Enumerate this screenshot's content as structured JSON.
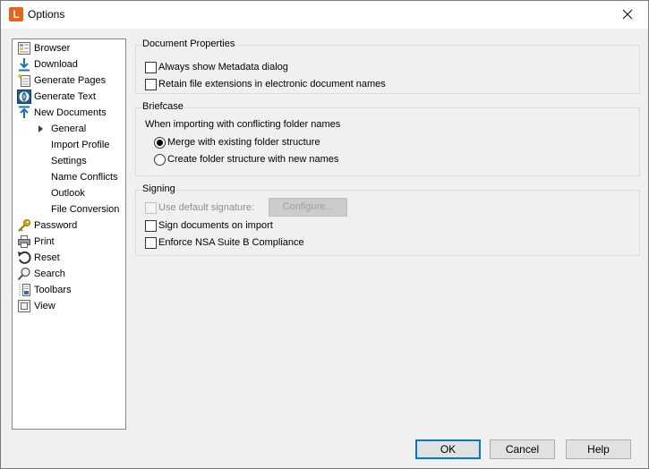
{
  "window": {
    "title": "Options",
    "app_icon_letter": "L",
    "accent": "#0078d7",
    "app_icon_color": "#e8641b"
  },
  "tree": {
    "items": [
      {
        "label": "Browser",
        "icon": "browser-icon"
      },
      {
        "label": "Download",
        "icon": "download-icon"
      },
      {
        "label": "Generate Pages",
        "icon": "generate-pages-icon"
      },
      {
        "label": "Generate Text",
        "icon": "generate-text-icon"
      },
      {
        "label": "New Documents",
        "icon": "new-documents-icon"
      },
      {
        "label": "Password",
        "icon": "key-icon"
      },
      {
        "label": "Print",
        "icon": "printer-icon"
      },
      {
        "label": "Reset",
        "icon": "reset-icon"
      },
      {
        "label": "Search",
        "icon": "search-icon"
      },
      {
        "label": "Toolbars",
        "icon": "toolbars-icon"
      },
      {
        "label": "View",
        "icon": "view-icon"
      }
    ],
    "subitems": [
      "General",
      "Import Profile",
      "Settings",
      "Name Conflicts",
      "Outlook",
      "File Conversion"
    ]
  },
  "document_properties": {
    "legend": "Document Properties",
    "always_show_metadata": "Always show Metadata dialog",
    "retain_extensions": "Retain file extensions in electronic document names"
  },
  "briefcase": {
    "legend": "Briefcase",
    "prompt": "When importing with conflicting folder names",
    "merge": "Merge with existing folder structure",
    "create": "Create folder structure with new names"
  },
  "signing": {
    "legend": "Signing",
    "use_default": "Use default signature:",
    "configure": "Configure...",
    "sign_on_import": "Sign documents on import",
    "enforce_nsa": "Enforce NSA Suite B Compliance"
  },
  "buttons": {
    "ok": "OK",
    "cancel": "Cancel",
    "help": "Help"
  }
}
